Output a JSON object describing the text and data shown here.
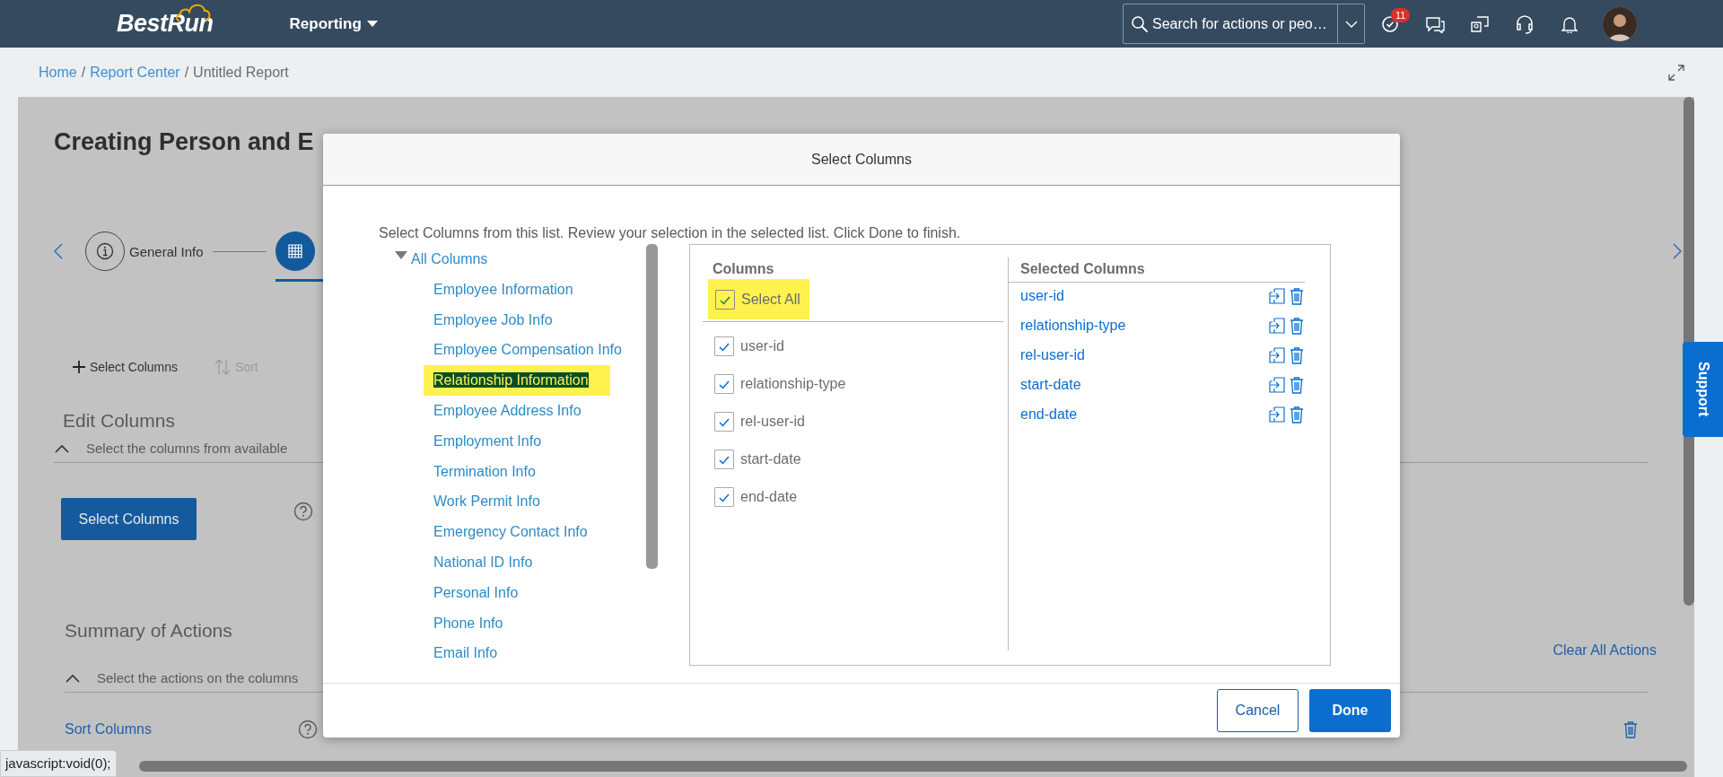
{
  "header": {
    "logo": "BestRun",
    "menu": "Reporting",
    "search": {
      "placeholder": "Search for actions or peo…"
    },
    "notification_count": "11"
  },
  "breadcrumbs": {
    "separator": "/",
    "items": [
      {
        "label": "Home",
        "link": true
      },
      {
        "label": "Report Center",
        "link": true
      },
      {
        "label": "Untitled Report",
        "link": false
      }
    ]
  },
  "page": {
    "title": "Creating Person and E",
    "steps": [
      {
        "kind": "info",
        "label": "General Info",
        "selected": false
      },
      {
        "kind": "grid",
        "selected": true
      }
    ],
    "toolbar": [
      {
        "kind": "add",
        "label": "Select Columns",
        "disabled": false
      },
      {
        "kind": "sort",
        "label": "Sort",
        "disabled": true
      }
    ],
    "edit_columns": {
      "title": "Edit Columns",
      "hint": "Select the columns from available",
      "button": "Select Columns"
    },
    "summary": {
      "title": "Summary of Actions",
      "hint": "Select the actions on the columns",
      "clear": "Clear All Actions",
      "actions": [
        {
          "label": "Sort Columns"
        }
      ]
    }
  },
  "support": "Support",
  "status_bar": "javascript:void(0);",
  "dialog": {
    "title": "Select Columns",
    "instruction": "Select Columns from this list. Review your selection in the selected list. Click Done to finish.",
    "tree": {
      "label": "All Columns",
      "expanded": true,
      "children": [
        {
          "label": "Employee Information",
          "selected": false,
          "highlighted": false
        },
        {
          "label": "Employee Job Info",
          "selected": false,
          "highlighted": false
        },
        {
          "label": "Employee Compensation Info",
          "selected": false,
          "highlighted": false
        },
        {
          "label": "Relationship Information",
          "selected": true,
          "highlighted": true
        },
        {
          "label": "Employee Address Info",
          "selected": false,
          "highlighted": false
        },
        {
          "label": "Employment Info",
          "selected": false,
          "highlighted": false
        },
        {
          "label": "Termination Info",
          "selected": false,
          "highlighted": false
        },
        {
          "label": "Work Permit Info",
          "selected": false,
          "highlighted": false
        },
        {
          "label": "Emergency Contact Info",
          "selected": false,
          "highlighted": false
        },
        {
          "label": "National ID Info",
          "selected": false,
          "highlighted": false
        },
        {
          "label": "Personal Info",
          "selected": false,
          "highlighted": false
        },
        {
          "label": "Phone Info",
          "selected": false,
          "highlighted": false
        },
        {
          "label": "Email Info",
          "selected": false,
          "highlighted": false
        }
      ]
    },
    "columns": {
      "heading": "Columns",
      "select_all": {
        "label": "Select All",
        "checked": true,
        "highlighted": true
      },
      "items": [
        {
          "label": "user-id",
          "checked": true
        },
        {
          "label": "relationship-type",
          "checked": true
        },
        {
          "label": "rel-user-id",
          "checked": true
        },
        {
          "label": "start-date",
          "checked": true
        },
        {
          "label": "end-date",
          "checked": true
        }
      ]
    },
    "selected_columns": {
      "heading": "Selected Columns",
      "items": [
        {
          "label": "user-id"
        },
        {
          "label": "relationship-type"
        },
        {
          "label": "rel-user-id"
        },
        {
          "label": "start-date"
        },
        {
          "label": "end-date"
        }
      ]
    },
    "buttons": [
      {
        "label": "Cancel",
        "kind": "secondary"
      },
      {
        "label": "Done",
        "kind": "primary"
      }
    ]
  }
}
